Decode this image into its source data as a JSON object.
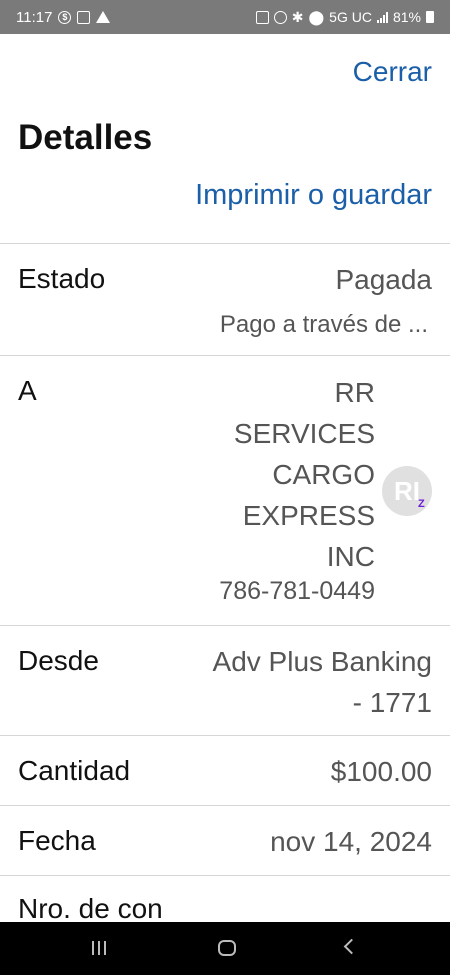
{
  "status_bar": {
    "time": "11:17",
    "network": "5G UC",
    "battery": "81%",
    "icons": [
      "dollar-icon",
      "image-icon",
      "navigation-icon",
      "battery-saver-icon",
      "alarm-icon",
      "bluetooth-icon",
      "location-icon",
      "signal-icon",
      "battery-icon"
    ]
  },
  "header": {
    "close_label": "Cerrar",
    "title": "Detalles",
    "print_label": "Imprimir o guardar"
  },
  "details": {
    "status": {
      "label": "Estado",
      "value": "Pagada",
      "sub": "Pago a través de ..."
    },
    "recipient": {
      "label": "A",
      "name": "RR SERVICES CARGO EXPRESS INC",
      "phone": "786-781-0449",
      "avatar_initials": "RI",
      "badge": "Z"
    },
    "from": {
      "label": "Desde",
      "value": "Adv Plus Banking - 1771"
    },
    "amount": {
      "label": "Cantidad",
      "value": "$100.00"
    },
    "date": {
      "label": "Fecha",
      "value": "nov 14, 2024"
    },
    "confirmation": {
      "label": "Nro. de con"
    }
  },
  "colors": {
    "link": "#1a5fa8",
    "status_bar": "#7a7a7a",
    "nav_bar": "#000000",
    "zelle": "#6d1ed4"
  }
}
